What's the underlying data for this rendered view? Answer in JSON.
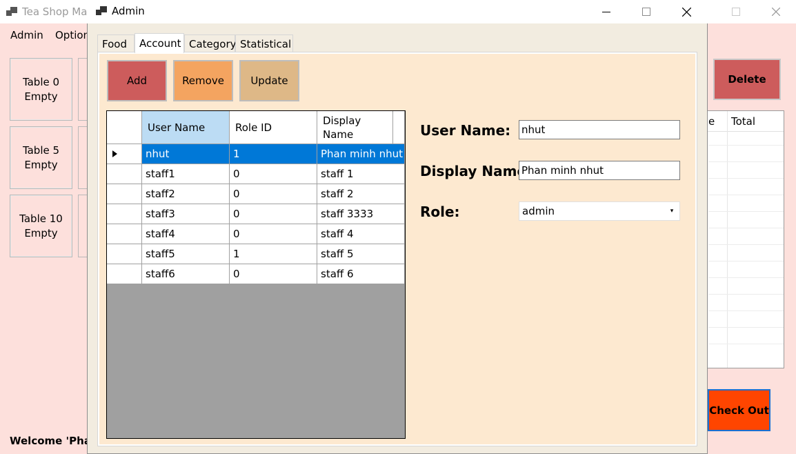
{
  "main_window": {
    "title": "Tea Shop Man",
    "menu": [
      "Admin",
      "Option"
    ],
    "tables": [
      {
        "name": "Table 0",
        "status": "Empty"
      },
      {
        "name": "Table 5",
        "status": "Empty"
      },
      {
        "name": "Table 10",
        "status": "Empty"
      }
    ],
    "delete_label": "Delete",
    "bill_columns": [
      "e",
      "Total"
    ],
    "checkout_label": "Check Out",
    "welcome_text": "Welcome 'Phan"
  },
  "admin_window": {
    "title": "Admin",
    "controls": {
      "minimize": "—",
      "maximize": "☐",
      "close": "✕"
    },
    "tabs": [
      "Food",
      "Account",
      "Category",
      "Statistical"
    ],
    "active_tab": "Account",
    "buttons": {
      "add": "Add",
      "remove": "Remove",
      "update": "Update"
    },
    "button_colors": {
      "add": "#cd5c5c",
      "remove": "#f4a460",
      "update": "#deb887"
    },
    "grid": {
      "columns": [
        "User Name",
        "Role ID",
        "Display Name"
      ],
      "rows": [
        {
          "user": "nhut",
          "role": "1",
          "display": "Phan minh nhut"
        },
        {
          "user": "staff1",
          "role": "0",
          "display": "staff 1"
        },
        {
          "user": "staff2",
          "role": "0",
          "display": "staff 2"
        },
        {
          "user": "staff3",
          "role": "0",
          "display": "staff 3333"
        },
        {
          "user": "staff4",
          "role": "0",
          "display": "staff 4"
        },
        {
          "user": "staff5",
          "role": "1",
          "display": "staff 5"
        },
        {
          "user": "staff6",
          "role": "0",
          "display": "staff 6"
        }
      ],
      "selected_row": 0
    },
    "form": {
      "username_label": "User Name:",
      "username_value": "nhut",
      "display_label": "Display Name:",
      "display_value": "Phan minh nhut",
      "role_label": "Role:",
      "role_value": "admin"
    }
  }
}
